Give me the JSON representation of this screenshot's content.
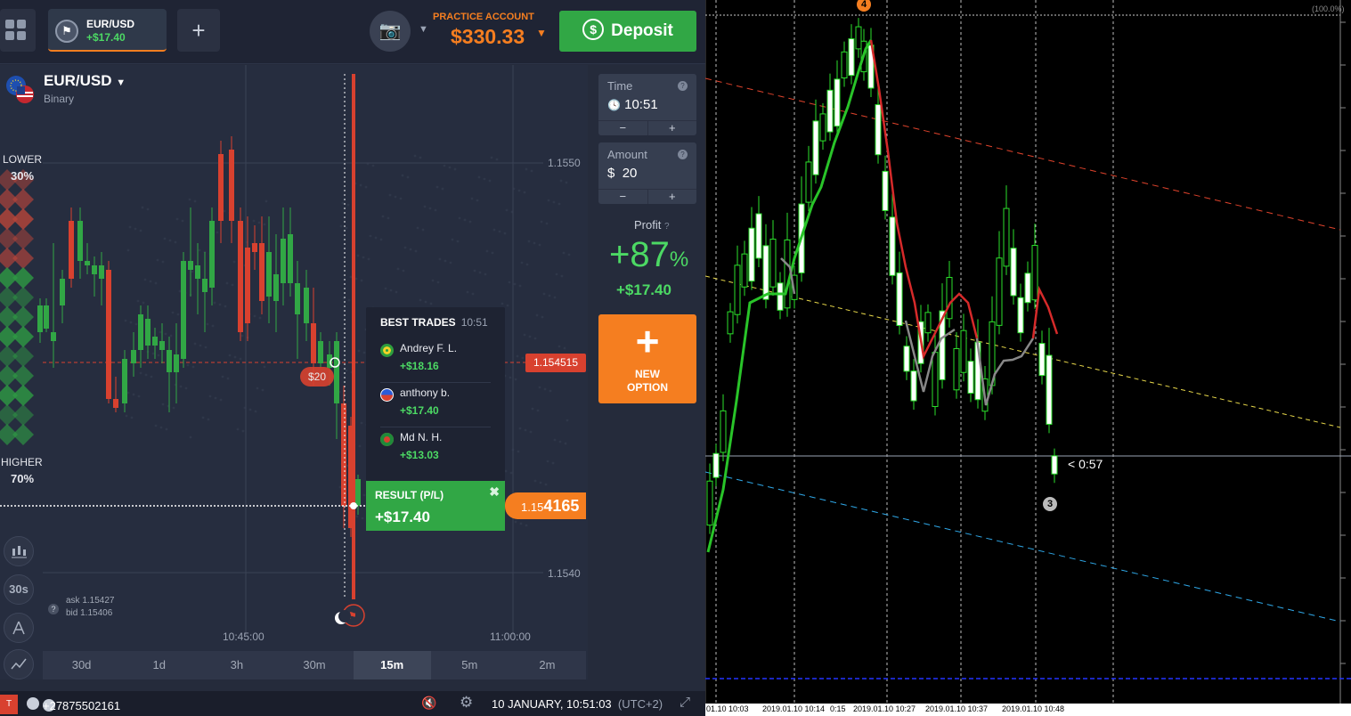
{
  "topbar": {
    "asset_tab_name": "EUR/USD",
    "asset_tab_pnl": "+$17.40",
    "add_tab": "+",
    "account_label": "PRACTICE ACCOUNT",
    "balance": "$330.33",
    "deposit_label": "Deposit"
  },
  "pair": {
    "name": "EUR/USD",
    "type": "Binary"
  },
  "sentiment": {
    "lower_label": "LOWER",
    "lower_pct": "30%",
    "higher_label": "HIGHER",
    "higher_pct": "70%"
  },
  "tools": {
    "timeframe": "30s"
  },
  "quote": {
    "ask": "ask 1.15427",
    "bid": "bid 1.15406"
  },
  "axis": {
    "prices": [
      "1.1550",
      "1.1540"
    ],
    "times": [
      "10:45:00",
      "11:00:00"
    ]
  },
  "timeframes": [
    "30d",
    "1d",
    "3h",
    "30m",
    "15m",
    "5m",
    "2m"
  ],
  "active_timeframe": "15m",
  "order": {
    "time_label": "Time",
    "time_value": "10:51",
    "amount_label": "Amount",
    "amount_value": "20",
    "currency": "$",
    "minus": "−",
    "plus": "+",
    "profit_label": "Profit",
    "profit_pct": "+87",
    "profit_pct_sign": "%",
    "profit_amount": "+$17.40",
    "new_option_line1": "NEW",
    "new_option_line2": "OPTION"
  },
  "best_trades": {
    "title": "BEST TRADES",
    "time": "10:51",
    "items": [
      {
        "name": "Andrey F. L.",
        "amount": "+$18.16",
        "flag_color": "#2e9e3e"
      },
      {
        "name": "anthony b.",
        "amount": "+$17.40",
        "flag_color": "#2a5bd8"
      },
      {
        "name": "Md N. H.",
        "amount": "+$13.03",
        "flag_color": "#1f8a3a"
      }
    ]
  },
  "result": {
    "label": "RESULT (P/L)",
    "value": "+$17.40"
  },
  "price_tags": {
    "current_prefix": "1.15",
    "current_suffix": "4165",
    "strike": "1.154515",
    "stake": "$20"
  },
  "statusbar": {
    "phone": "+27875502161",
    "datetime": "10 JANUARY, 10:51:03",
    "tz": "(UTC+2)",
    "left_tag": "T"
  },
  "mt4": {
    "scale": "(100.0%)",
    "countdown": "< 0:57",
    "marker_top": "4",
    "marker_bottom": "3",
    "time_labels": [
      "01.10 10:03",
      "2019.01.10 10:14",
      "0:15",
      "2019.01.10 10:27",
      "2019.01.10 10:37",
      "2019.01.10 10:48"
    ]
  },
  "colors": {
    "green": "#31a745",
    "orange": "#f57e20",
    "red": "#d8412f"
  }
}
